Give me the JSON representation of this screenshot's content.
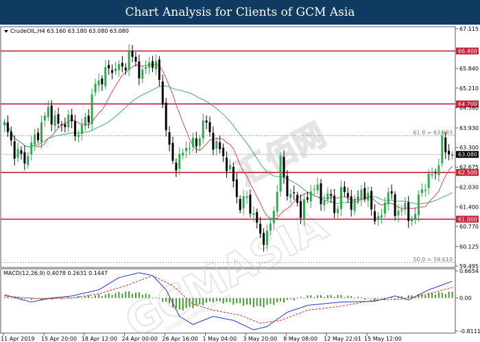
{
  "header": {
    "title": "Chart Analysis for Clients of GCM Asia"
  },
  "chart_data": {
    "type": "candlestick",
    "symbol_info": "CrudeOIL,H4  63.160 63.180 63.080 63.080",
    "ohlc_last": {
      "open": 63.16,
      "high": 63.18,
      "low": 63.08,
      "close": 63.08
    },
    "ylim": [
      59.495,
      67.115
    ],
    "yticks": [
      "67.115",
      "66.400",
      "65.840",
      "65.210",
      "64.700",
      "64.580",
      "63.930",
      "63.300",
      "63.080",
      "62.675",
      "62.500",
      "62.030",
      "61.400",
      "61.000",
      "60.770",
      "60.125",
      "59.495"
    ],
    "xticks": [
      "11 Apr 2019",
      "15 Apr 20:00",
      "18 Apr 12:00",
      "24 Apr 00:00",
      "26 Apr 16:00",
      "1 May 04:00",
      "3 May 20:00",
      "8 May 08:00",
      "12 May 22:01",
      "15 May 12:00"
    ],
    "resistance_levels": [
      {
        "value": 66.4,
        "label": "66.400"
      },
      {
        "value": 64.7,
        "label": "64.700"
      }
    ],
    "support_levels": [
      {
        "value": 62.5,
        "label": "62.500"
      },
      {
        "value": 61.0,
        "label": "61.000"
      }
    ],
    "current_price": {
      "value": 63.08,
      "label": "63.080"
    },
    "fibonacci": [
      {
        "value": 63.683,
        "label": "61.8 = 63.683"
      },
      {
        "value": 59.61,
        "label": "50.0 = 59.610"
      }
    ],
    "anchors": [
      [
        0,
        64.0
      ],
      [
        3,
        63.2
      ],
      [
        6,
        62.9
      ],
      [
        10,
        63.8
      ],
      [
        13,
        64.5
      ],
      [
        16,
        64.0
      ],
      [
        19,
        64.2
      ],
      [
        22,
        63.7
      ],
      [
        25,
        64.4
      ],
      [
        27,
        65.3
      ],
      [
        30,
        65.7
      ],
      [
        33,
        65.9
      ],
      [
        35,
        65.8
      ],
      [
        37,
        66.3
      ],
      [
        39,
        66.0
      ],
      [
        41,
        65.6
      ],
      [
        43,
        66.1
      ],
      [
        45,
        65.9
      ],
      [
        47,
        64.9
      ],
      [
        48,
        63.8
      ],
      [
        50,
        62.8
      ],
      [
        52,
        62.9
      ],
      [
        55,
        63.5
      ],
      [
        57,
        63.3
      ],
      [
        59,
        64.2
      ],
      [
        62,
        63.5
      ],
      [
        64,
        63.2
      ],
      [
        66,
        62.8
      ],
      [
        68,
        62.2
      ],
      [
        70,
        61.4
      ],
      [
        72,
        61.7
      ],
      [
        74,
        61.1
      ],
      [
        76,
        60.5
      ],
      [
        78,
        60.4
      ],
      [
        80,
        61.3
      ],
      [
        82,
        62.8
      ],
      [
        84,
        61.9
      ],
      [
        86,
        61.7
      ],
      [
        88,
        61.3
      ],
      [
        90,
        61.6
      ],
      [
        92,
        62.2
      ],
      [
        94,
        61.5
      ],
      [
        96,
        61.9
      ],
      [
        98,
        61.2
      ],
      [
        100,
        61.9
      ],
      [
        102,
        61.7
      ],
      [
        104,
        61.4
      ],
      [
        106,
        62.0
      ],
      [
        108,
        61.6
      ],
      [
        110,
        61.1
      ],
      [
        112,
        61.0
      ],
      [
        114,
        62.1
      ],
      [
        116,
        61.1
      ],
      [
        118,
        61.5
      ],
      [
        120,
        61.0
      ],
      [
        122,
        61.2
      ],
      [
        124,
        62.0
      ],
      [
        126,
        62.3
      ],
      [
        128,
        62.5
      ],
      [
        130,
        63.4
      ],
      [
        131,
        63.2
      ],
      [
        133,
        63.1
      ]
    ],
    "macd": {
      "label": "MACD(12,26,9)",
      "values_text": "0.4078 0.2631 0.1447",
      "ylim": [
        -0.8111,
        0.6654
      ],
      "yticks": [
        "0.6654",
        "0.00",
        "-0.8111"
      ],
      "histogram": [
        [
          0,
          0.02
        ],
        [
          10,
          -0.03
        ],
        [
          20,
          0.01
        ],
        [
          30,
          0.08
        ],
        [
          36,
          0.15
        ],
        [
          42,
          0.1
        ],
        [
          48,
          -0.1
        ],
        [
          52,
          -0.3
        ],
        [
          56,
          -0.22
        ],
        [
          62,
          -0.08
        ],
        [
          70,
          -0.15
        ],
        [
          76,
          -0.22
        ],
        [
          82,
          -0.1
        ],
        [
          90,
          0.05
        ],
        [
          100,
          0.06
        ],
        [
          110,
          -0.04
        ],
        [
          118,
          0.03
        ],
        [
          126,
          0.1
        ],
        [
          133,
          0.14
        ]
      ],
      "signal": [
        [
          0,
          0.05
        ],
        [
          10,
          -0.02
        ],
        [
          20,
          0.0
        ],
        [
          28,
          0.1
        ],
        [
          36,
          0.3
        ],
        [
          44,
          0.55
        ],
        [
          50,
          0.3
        ],
        [
          56,
          -0.15
        ],
        [
          62,
          -0.3
        ],
        [
          70,
          -0.42
        ],
        [
          76,
          -0.62
        ],
        [
          82,
          -0.55
        ],
        [
          90,
          -0.3
        ],
        [
          100,
          -0.2
        ],
        [
          110,
          -0.05
        ],
        [
          118,
          -0.03
        ],
        [
          126,
          0.1
        ],
        [
          133,
          0.26
        ]
      ],
      "line": [
        [
          0,
          0.08
        ],
        [
          8,
          -0.1
        ],
        [
          14,
          0.0
        ],
        [
          20,
          0.05
        ],
        [
          28,
          0.2
        ],
        [
          34,
          0.5
        ],
        [
          40,
          0.62
        ],
        [
          44,
          0.55
        ],
        [
          48,
          0.2
        ],
        [
          52,
          -0.45
        ],
        [
          56,
          -0.65
        ],
        [
          62,
          -0.45
        ],
        [
          68,
          -0.55
        ],
        [
          74,
          -0.78
        ],
        [
          78,
          -0.7
        ],
        [
          84,
          -0.35
        ],
        [
          90,
          -0.18
        ],
        [
          100,
          -0.1
        ],
        [
          110,
          -0.08
        ],
        [
          116,
          0.05
        ],
        [
          120,
          -0.05
        ],
        [
          126,
          0.2
        ],
        [
          130,
          0.32
        ],
        [
          133,
          0.41
        ]
      ]
    }
  },
  "colors": {
    "bull": "#2fa84f",
    "bear": "#000000",
    "level_line": "#cc1f36",
    "ma_fast": "#d9485a",
    "ma_slow": "#3fae77",
    "macd_line": "#2233cc",
    "macd_signal": "#d92424",
    "macd_hist": "#3d9a2e",
    "price_tag_bg": "#000000",
    "price_tag_text": "#ffffff"
  },
  "watermark": {
    "text": "GCMASIA",
    "cn": "汇佰网",
    "sub": "GLOBAL CAPITAL MARKETS"
  }
}
